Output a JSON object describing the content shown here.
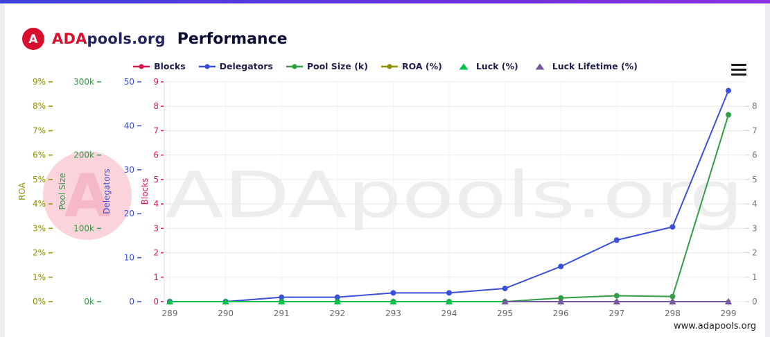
{
  "brand": {
    "ada": "ADA",
    "suffix": "pools.org",
    "logo_letter": "A"
  },
  "title": "Performance",
  "footer_url": "www.adapools.org",
  "watermark": {
    "text": "ADApools.org",
    "circle_letter": "A"
  },
  "colors": {
    "gradient_left": "#3d44d8",
    "gradient_right": "#8a33e0",
    "brand_red": "#d8102e",
    "brand_dark": "#232360",
    "title_text": "#0d0d36",
    "legend_text": "#20204e",
    "grid": "#e8e8e8",
    "grid_vertical": "#f2f2f2",
    "axis_border": "#dddddd",
    "watermark_text": "#ededed",
    "watermark_pink": "#fad3db",
    "watermark_pink_letter": "#f5b8c6"
  },
  "chart_data": {
    "type": "line",
    "x": [
      289,
      290,
      291,
      292,
      293,
      294,
      295,
      296,
      297,
      298,
      299
    ],
    "series": [
      {
        "name": "Blocks",
        "color": "#d81b4a",
        "axis": "blocks",
        "marker": "circle",
        "values": [
          0,
          0,
          0,
          0,
          0,
          0,
          0,
          0,
          0,
          0,
          0
        ]
      },
      {
        "name": "Delegators",
        "color": "#3a50d9",
        "axis": "delegators",
        "marker": "circle",
        "values": [
          0,
          0,
          1,
          1,
          2,
          2,
          3,
          8,
          14,
          17,
          48
        ]
      },
      {
        "name": "Pool Size (k)",
        "color": "#2f9e44",
        "axis": "pool",
        "marker": "circle",
        "values": [
          0,
          0,
          0,
          0,
          0,
          0,
          0,
          5,
          8,
          7,
          255
        ]
      },
      {
        "name": "ROA (%)",
        "color": "#8f8f00",
        "axis": "roa",
        "marker": "circle",
        "values": [
          0,
          0,
          0,
          0,
          0,
          0,
          0,
          0,
          0,
          0,
          0
        ]
      },
      {
        "name": "Luck (%)",
        "color": "#00c24b",
        "axis": "roa",
        "marker": "triangle",
        "values": [
          0,
          0,
          0,
          0,
          0,
          0,
          0,
          0,
          0,
          0,
          0
        ]
      },
      {
        "name": "Luck Lifetime (%)",
        "color": "#7557a5",
        "axis": "roa",
        "marker": "triangle",
        "values": [
          null,
          null,
          null,
          null,
          null,
          null,
          0,
          0,
          0,
          0,
          0
        ]
      }
    ],
    "axes": {
      "roa": {
        "title": "ROA",
        "color": "#8f8f00",
        "min": 0,
        "max": 9,
        "tick_step": 1,
        "tick_suffix": "%"
      },
      "pool": {
        "title": "Pool Size",
        "color": "#2f9e44",
        "min": 0,
        "max": 300,
        "tick_step": 100,
        "tick_suffix": "k"
      },
      "delegators": {
        "title": "Delegators",
        "color": "#3a50d9",
        "min": 0,
        "max": 50,
        "tick_step": 10,
        "tick_suffix": ""
      },
      "blocks": {
        "title": "Blocks",
        "color": "#d81b4a",
        "min": 0,
        "max": 9,
        "tick_step": 1,
        "tick_suffix": ""
      },
      "right": {
        "title": "",
        "color": "#777777",
        "min": 0,
        "max": 9,
        "tick_step": 1,
        "tick_max": 8,
        "tick_suffix": ""
      }
    },
    "x_axis": {
      "color": "#666666"
    },
    "grid": true,
    "legend_position": "top"
  }
}
